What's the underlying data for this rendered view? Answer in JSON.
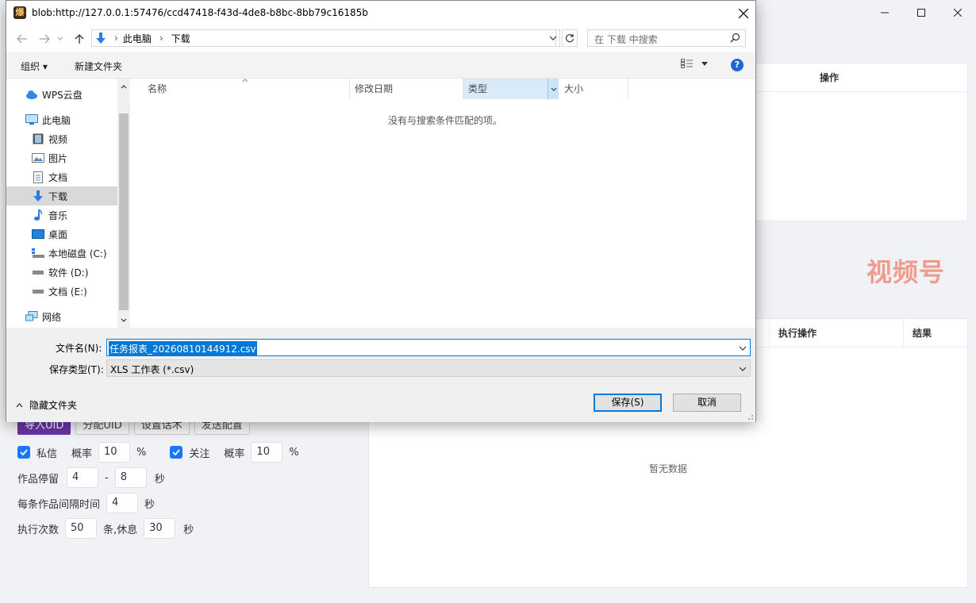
{
  "app": {
    "panel_top_header": "操作",
    "brand_text": "视频号",
    "panel_mid_headers": [
      "执行操作",
      "结果"
    ],
    "empty_text": "暂无数据",
    "buttons": [
      "导入UID",
      "分配UID",
      "设置话术",
      "发送配置"
    ],
    "row1": {
      "private_label": "私信",
      "rate_label": "概率",
      "private_rate": "10",
      "pct": "%",
      "follow_label": "关注",
      "follow_rate": "10"
    },
    "row2": {
      "label": "作品停留",
      "from": "4",
      "dash": "-",
      "to": "8",
      "unit": "秒"
    },
    "row3": {
      "label": "每条作品间隔时间",
      "value": "4",
      "unit": "秒"
    },
    "row4": {
      "label": "执行次数",
      "count": "50",
      "mid": "条,休息",
      "rest": "30",
      "unit": "秒"
    }
  },
  "dialog": {
    "title": "blob:http://127.0.0.1:57476/ccd47418-f43d-4de8-b8bc-8bb79c16185b",
    "icon_glyph": "爆",
    "breadcrumb": [
      "此电脑",
      "下载"
    ],
    "search_placeholder": "在 下载 中搜索",
    "organize": "组织 ▾",
    "new_folder": "新建文件夹",
    "nav_items": [
      {
        "label": "WPS云盘",
        "icon": "cloud-icon"
      },
      {
        "label": "此电脑",
        "icon": "computer-icon"
      },
      {
        "label": "视频",
        "icon": "video-icon"
      },
      {
        "label": "图片",
        "icon": "picture-icon"
      },
      {
        "label": "文档",
        "icon": "document-icon"
      },
      {
        "label": "下载",
        "icon": "download-icon"
      },
      {
        "label": "音乐",
        "icon": "music-icon"
      },
      {
        "label": "桌面",
        "icon": "desktop-icon"
      },
      {
        "label": "本地磁盘 (C:)",
        "icon": "drive-icon"
      },
      {
        "label": "软件 (D:)",
        "icon": "drive-icon"
      },
      {
        "label": "文档 (E:)",
        "icon": "drive-icon"
      },
      {
        "label": "网络",
        "icon": "network-icon"
      }
    ],
    "columns": [
      "名称",
      "修改日期",
      "类型",
      "大小"
    ],
    "no_match": "没有与搜索条件匹配的项。",
    "filename_label": "文件名(N):",
    "filename_value": "任务报表_20260810144912.csv",
    "filetype_label": "保存类型(T):",
    "filetype_value": "XLS 工作表 (*.csv)",
    "hide_folders": "隐藏文件夹",
    "save_button": "保存(S)",
    "cancel_button": "取消"
  },
  "colors": {
    "accent": "#0078d7",
    "brand": "#f19a8e",
    "import_button": "#6a35a6",
    "checkbox": "#1677ff"
  }
}
